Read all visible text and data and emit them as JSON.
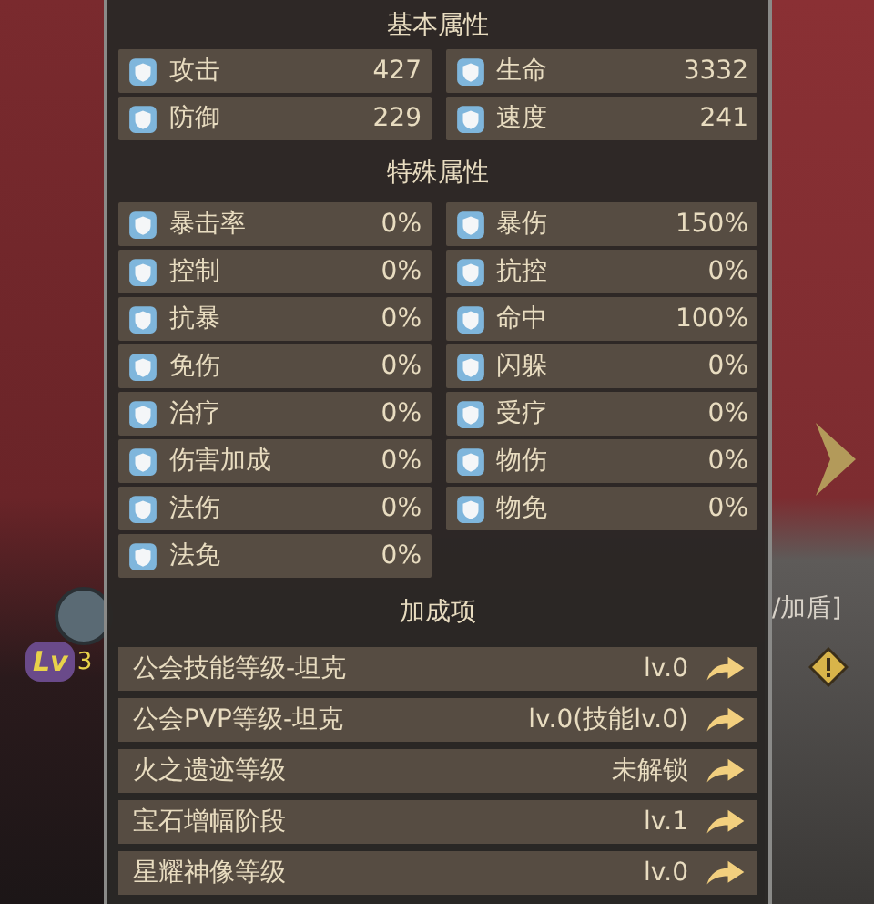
{
  "background": {
    "level_badge": "Lv",
    "level_digit": "3",
    "side_text": "/加盾]"
  },
  "sections": [
    {
      "title": "基本属性",
      "kind": "stats",
      "items": [
        {
          "name": "攻击",
          "value": "427"
        },
        {
          "name": "生命",
          "value": "3332"
        },
        {
          "name": "防御",
          "value": "229"
        },
        {
          "name": "速度",
          "value": "241"
        }
      ]
    },
    {
      "title": "特殊属性",
      "kind": "stats",
      "items": [
        {
          "name": "暴击率",
          "value": "0%"
        },
        {
          "name": "暴伤",
          "value": "150%"
        },
        {
          "name": "控制",
          "value": "0%"
        },
        {
          "name": "抗控",
          "value": "0%"
        },
        {
          "name": "抗暴",
          "value": "0%"
        },
        {
          "name": "命中",
          "value": "100%"
        },
        {
          "name": "免伤",
          "value": "0%"
        },
        {
          "name": "闪躲",
          "value": "0%"
        },
        {
          "name": "治疗",
          "value": "0%"
        },
        {
          "name": "受疗",
          "value": "0%"
        },
        {
          "name": "伤害加成",
          "value": "0%"
        },
        {
          "name": "物伤",
          "value": "0%"
        },
        {
          "name": "法伤",
          "value": "0%"
        },
        {
          "name": "物免",
          "value": "0%"
        },
        {
          "name": "法免",
          "value": "0%"
        }
      ]
    },
    {
      "title": "加成项",
      "kind": "bonus",
      "items": [
        {
          "name": "公会技能等级-坦克",
          "value": "lv.0"
        },
        {
          "name": "公会PVP等级-坦克",
          "value": "lv.0(技能lv.0)"
        },
        {
          "name": "火之遗迹等级",
          "value": "未解锁"
        },
        {
          "name": "宝石增幅阶段",
          "value": "lv.1"
        },
        {
          "name": "星耀神像等级",
          "value": "lv.0"
        }
      ]
    }
  ]
}
